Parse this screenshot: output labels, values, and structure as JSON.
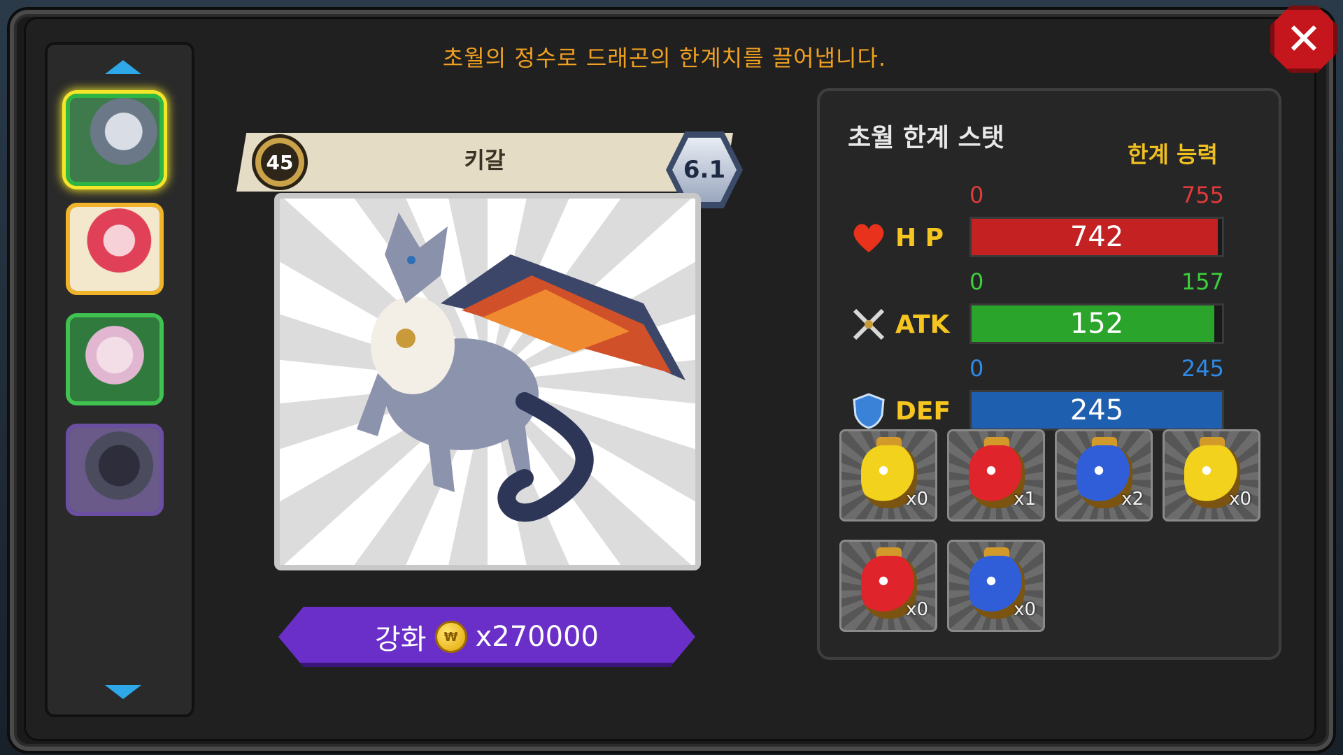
{
  "header": {
    "title": "초월의 정수로 드래곤의 한계치를 끌어냅니다."
  },
  "close_button": {
    "icon": "close-icon",
    "color": "#c4161c"
  },
  "dragon_list": {
    "items": [
      {
        "name": "dragon-thumb-1",
        "selected": true
      },
      {
        "name": "dragon-thumb-2",
        "selected": false
      },
      {
        "name": "dragon-thumb-3",
        "selected": false
      },
      {
        "name": "dragon-thumb-4",
        "selected": false
      }
    ]
  },
  "dragon": {
    "name": "키갈",
    "level": "45",
    "grade": "6.1"
  },
  "upgrade": {
    "label": "강화",
    "cost": "x270000",
    "coin_symbol": "₩"
  },
  "stats_panel": {
    "title": "초월 한계 스탯",
    "limit_label": "한계 능력",
    "stats": [
      {
        "key": "hp",
        "label": "H P",
        "min": "0",
        "max": "755",
        "value": "742",
        "fill": 0.983,
        "bar_color": "#c42222",
        "range_color": "#e03a3a"
      },
      {
        "key": "atk",
        "label": "ATK",
        "min": "0",
        "max": "157",
        "value": "152",
        "fill": 0.968,
        "bar_color": "#2aa42a",
        "range_color": "#3ccf3c"
      },
      {
        "key": "def",
        "label": "DEF",
        "min": "0",
        "max": "245",
        "value": "245",
        "fill": 1.0,
        "bar_color": "#1f5fb0",
        "range_color": "#2f8ae6"
      }
    ]
  },
  "potions": [
    {
      "color": "#f2d21c",
      "count": "x0"
    },
    {
      "color": "#e0242c",
      "count": "x1"
    },
    {
      "color": "#2f5ed8",
      "count": "x2"
    },
    {
      "color": "#f2d21c",
      "count": "x0"
    },
    {
      "color": "#e0242c",
      "count": "x0"
    },
    {
      "color": "#2f5ed8",
      "count": "x0"
    }
  ]
}
